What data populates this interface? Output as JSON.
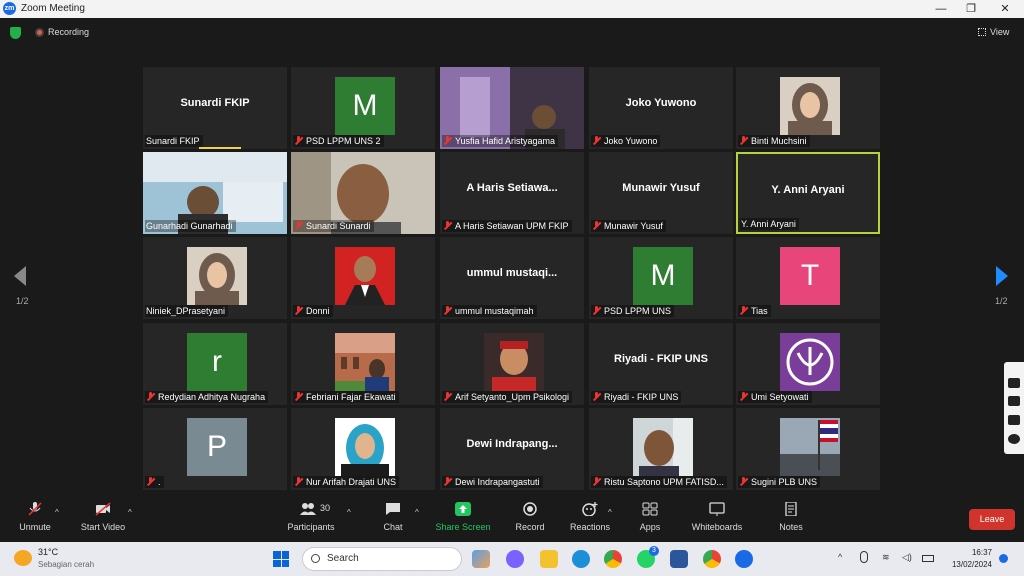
{
  "window": {
    "app_icon": "zm",
    "title": "Zoom Meeting",
    "controls": [
      "—",
      "❐",
      "✕"
    ]
  },
  "meeting": {
    "recording_label": "Recording",
    "view_label": "View",
    "page_indicator_left": "1/2",
    "page_indicator_right": "1/2"
  },
  "tiles": [
    {
      "name": "Sunardi FKIP",
      "big": "Sunardi FKIP",
      "muted": false,
      "kind": "text"
    },
    {
      "name": "PSD LPPM UNS 2",
      "avatar": "M",
      "avatar_color": "#2e7d32",
      "muted": true,
      "kind": "avatar"
    },
    {
      "name": "Yusfia Hafid Aristyagama",
      "muted": true,
      "kind": "video",
      "scene": "room-purple"
    },
    {
      "name": "Joko Yuwono",
      "big": "Joko Yuwono",
      "muted": true,
      "kind": "text"
    },
    {
      "name": "Binti Muchsini",
      "muted": true,
      "kind": "photo",
      "scene": "hijab-woman"
    },
    {
      "name": "Gunarhadi Gunarhadi",
      "muted": false,
      "kind": "video",
      "scene": "banner-room"
    },
    {
      "name": "Sunardi Sunardi",
      "muted": true,
      "kind": "video",
      "scene": "man-face"
    },
    {
      "name": "A Haris Setiawan UPM FKIP",
      "big": "A  Haris  Setiawa...",
      "muted": true,
      "kind": "text"
    },
    {
      "name": "Munawir Yusuf",
      "big": "Munawir Yusuf",
      "muted": true,
      "kind": "text"
    },
    {
      "name": "Y. Anni Aryani",
      "big": "Y. Anni Aryani",
      "muted": false,
      "kind": "text",
      "highlight": true
    },
    {
      "name": "Niniek_DPrasetyani",
      "muted": false,
      "kind": "photo",
      "scene": "hijab-woman"
    },
    {
      "name": "Donni",
      "muted": true,
      "kind": "photo",
      "scene": "red-portrait"
    },
    {
      "name": "ummul mustaqimah",
      "big": "ummul  mustaqi...",
      "muted": true,
      "kind": "text"
    },
    {
      "name": "PSD LPPM UNS",
      "avatar": "M",
      "avatar_color": "#2e7d32",
      "muted": true,
      "kind": "avatar"
    },
    {
      "name": "Tias",
      "avatar": "T",
      "avatar_color": "#e8457a",
      "muted": true,
      "kind": "avatar"
    },
    {
      "name": "Redydian Adhitya Nugraha",
      "avatar": "r",
      "avatar_color": "#2e7d32",
      "muted": true,
      "kind": "avatar"
    },
    {
      "name": "Febriani Fajar Ekawati",
      "muted": true,
      "kind": "photo",
      "scene": "building"
    },
    {
      "name": "Arif Setyanto_Upm Psikologi",
      "muted": true,
      "kind": "photo",
      "scene": "red-portrait2"
    },
    {
      "name": "Riyadi - FKIP UNS",
      "big": "Riyadi - FKIP UNS",
      "muted": true,
      "kind": "text"
    },
    {
      "name": "Umi Setyowati",
      "muted": true,
      "kind": "photo",
      "scene": "logo-purple"
    },
    {
      "name": ".",
      "avatar": "P",
      "avatar_color": "#7a8a93",
      "muted": true,
      "kind": "avatar"
    },
    {
      "name": "Nur Arifah Drajati UNS",
      "muted": true,
      "kind": "photo",
      "scene": "hijab-blue"
    },
    {
      "name": "Dewi Indrapangastuti",
      "big": "Dewi  Indrapang...",
      "muted": true,
      "kind": "text"
    },
    {
      "name": "Ristu Saptono UPM FATISD...",
      "muted": true,
      "kind": "photo",
      "scene": "man-face2"
    },
    {
      "name": "Sugini PLB UNS",
      "muted": true,
      "kind": "photo",
      "scene": "flag"
    }
  ],
  "controls": {
    "unmute": "Unmute",
    "start_video": "Start Video",
    "participants": "Participants",
    "participants_count": "30",
    "chat": "Chat",
    "share_screen": "Share Screen",
    "record": "Record",
    "reactions": "Reactions",
    "apps": "Apps",
    "whiteboards": "Whiteboards",
    "notes": "Notes",
    "leave": "Leave"
  },
  "taskbar": {
    "temperature": "31°C",
    "weather": "Sebagian cerah",
    "search_placeholder": "Search",
    "time": "16:37",
    "date": "13/02/2024",
    "badge_count": "3"
  },
  "colors": {
    "accent_blue": "#1f8cff",
    "share_green": "#22c55e",
    "leave_red": "#d0342c",
    "highlight": "#b5d43a"
  }
}
